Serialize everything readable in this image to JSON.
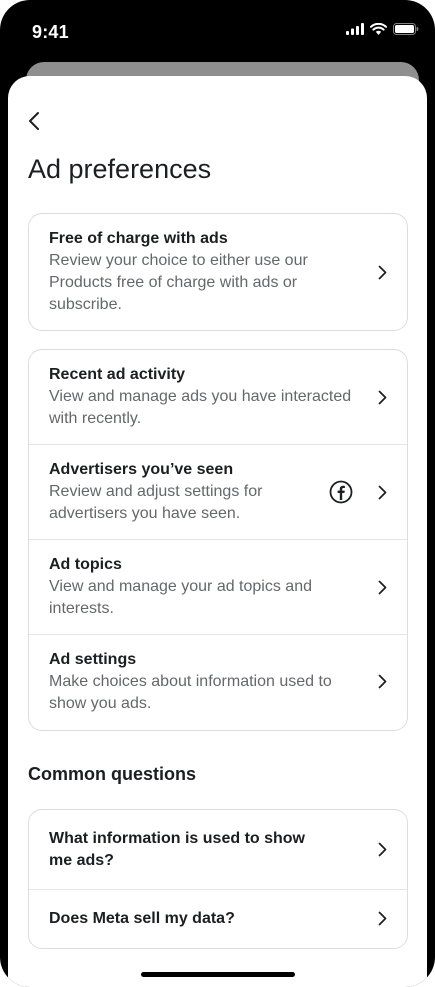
{
  "status_bar": {
    "time": "9:41"
  },
  "header": {
    "title": "Ad preferences"
  },
  "card_subscription": {
    "title": "Free of charge with ads",
    "description": "Review your choice to either use our Products free of charge with ads or subscribe."
  },
  "card_activity": {
    "items": [
      {
        "title": "Recent ad activity",
        "description": "View and manage ads you have interacted with recently."
      },
      {
        "title": "Advertisers you’ve seen",
        "description": "Review and adjust settings for advertisers you have seen.",
        "icon": "facebook-icon"
      },
      {
        "title": "Ad topics",
        "description": "View and manage your ad topics and interests."
      },
      {
        "title": "Ad settings",
        "description": "Make choices about information used to show you ads."
      }
    ]
  },
  "common_questions": {
    "title": "Common questions",
    "items": [
      {
        "label": "What information is used to show me ads?"
      },
      {
        "label": "Does Meta sell my data?"
      }
    ]
  },
  "colors": {
    "text_primary": "#1c1e21",
    "text_secondary": "#65676b",
    "border": "#dadde1"
  }
}
